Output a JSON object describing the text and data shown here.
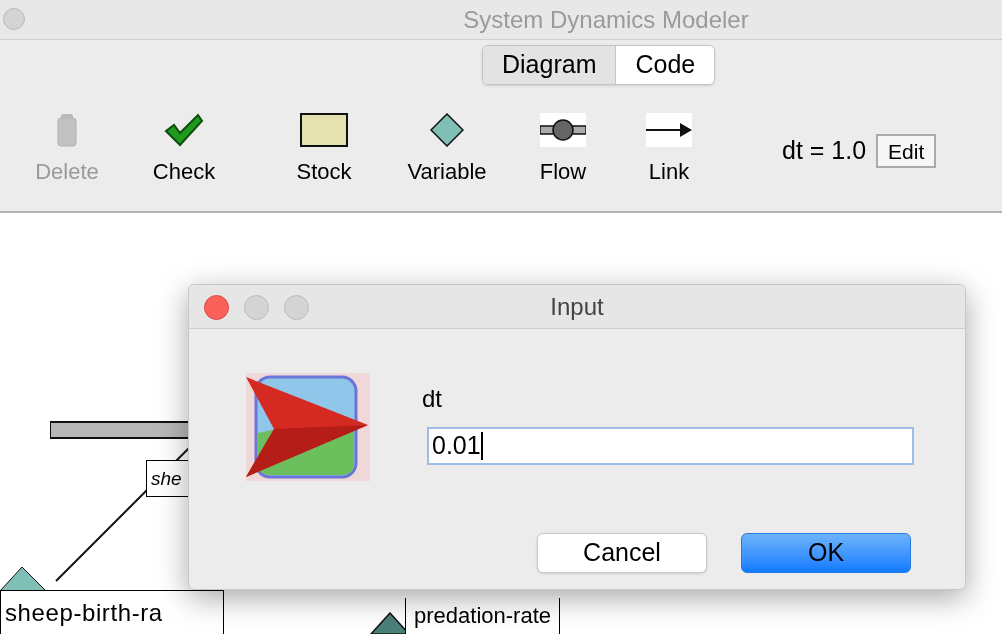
{
  "window": {
    "title": "System Dynamics Modeler"
  },
  "tabs": [
    {
      "label": "Diagram",
      "selected": true
    },
    {
      "label": "Code",
      "selected": false
    }
  ],
  "toolbar": {
    "tools": [
      {
        "kind": "delete",
        "label": "Delete",
        "disabled": true
      },
      {
        "kind": "check",
        "label": "Check",
        "disabled": false
      },
      {
        "kind": "stock",
        "label": "Stock",
        "disabled": false
      },
      {
        "kind": "variable",
        "label": "Variable",
        "disabled": false
      },
      {
        "kind": "flow",
        "label": "Flow",
        "disabled": false
      },
      {
        "kind": "link",
        "label": "Link",
        "disabled": false
      }
    ],
    "dt_reading": "dt = 1.0",
    "edit_button": "Edit"
  },
  "diagram": {
    "labels": [
      {
        "kind": "italic-box",
        "text": "she"
      },
      {
        "kind": "stock-box",
        "text": "sheep-birth-ra"
      },
      {
        "kind": "variable-box",
        "text": "predation-rate"
      }
    ]
  },
  "dialog": {
    "title": "Input",
    "field_label": "dt",
    "value": "0.01",
    "buttons": [
      {
        "label": "Cancel",
        "default": false
      },
      {
        "label": "OK",
        "default": true
      }
    ]
  }
}
